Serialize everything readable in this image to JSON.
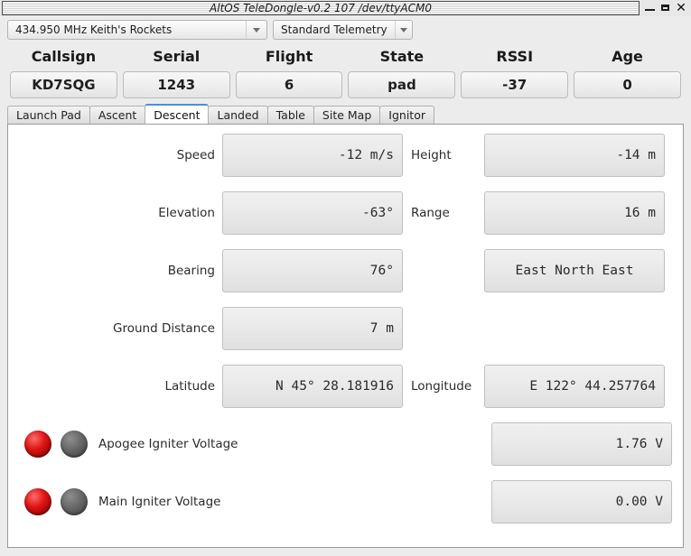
{
  "window": {
    "title": "AltOS TeleDongle-v0.2 107 /dev/ttyACM0",
    "minimize": "—",
    "maximize": "□",
    "close": "✕"
  },
  "toolbar": {
    "frequency": "434.950 MHz Keith's Rockets",
    "telemetry": "Standard Telemetry"
  },
  "status": {
    "columns": [
      {
        "label": "Callsign",
        "value": "KD7SQG"
      },
      {
        "label": "Serial",
        "value": "1243"
      },
      {
        "label": "Flight",
        "value": "6"
      },
      {
        "label": "State",
        "value": "pad"
      },
      {
        "label": "RSSI",
        "value": "-37"
      },
      {
        "label": "Age",
        "value": "0"
      }
    ]
  },
  "tabs": [
    {
      "label": "Launch Pad",
      "active": false
    },
    {
      "label": "Ascent",
      "active": false
    },
    {
      "label": "Descent",
      "active": true
    },
    {
      "label": "Landed",
      "active": false
    },
    {
      "label": "Table",
      "active": false
    },
    {
      "label": "Site Map",
      "active": false
    },
    {
      "label": "Ignitor",
      "active": false
    }
  ],
  "descent": {
    "rows": [
      {
        "left_label": "Speed",
        "left_value": "-12 m/s",
        "right_label": "Height",
        "right_value": "-14 m"
      },
      {
        "left_label": "Elevation",
        "left_value": "-63°",
        "right_label": "Range",
        "right_value": "16 m"
      },
      {
        "left_label": "Bearing",
        "left_value": "76°",
        "right_label": "",
        "right_value": "East North East"
      },
      {
        "left_label": "Ground Distance",
        "left_value": "7 m",
        "right_label": "",
        "right_value": ""
      },
      {
        "left_label": "Latitude",
        "left_value": "N 45° 28.181916",
        "right_label": "Longitude",
        "right_value": "E 122° 44.257764"
      }
    ],
    "igniters": [
      {
        "label": "Apogee Igniter Voltage",
        "value": "1.76 V",
        "led_a": "red-on",
        "led_b": "gray-off"
      },
      {
        "label": "Main Igniter Voltage",
        "value": "0.00 V",
        "led_a": "red-on",
        "led_b": "gray-off"
      }
    ]
  },
  "colors": {
    "active_tab_accent": "#4a90d9",
    "led_on": "#e01414",
    "led_off": "#6a6a6a",
    "window_bg": "#ececec",
    "panel_bg": "#ffffff"
  }
}
